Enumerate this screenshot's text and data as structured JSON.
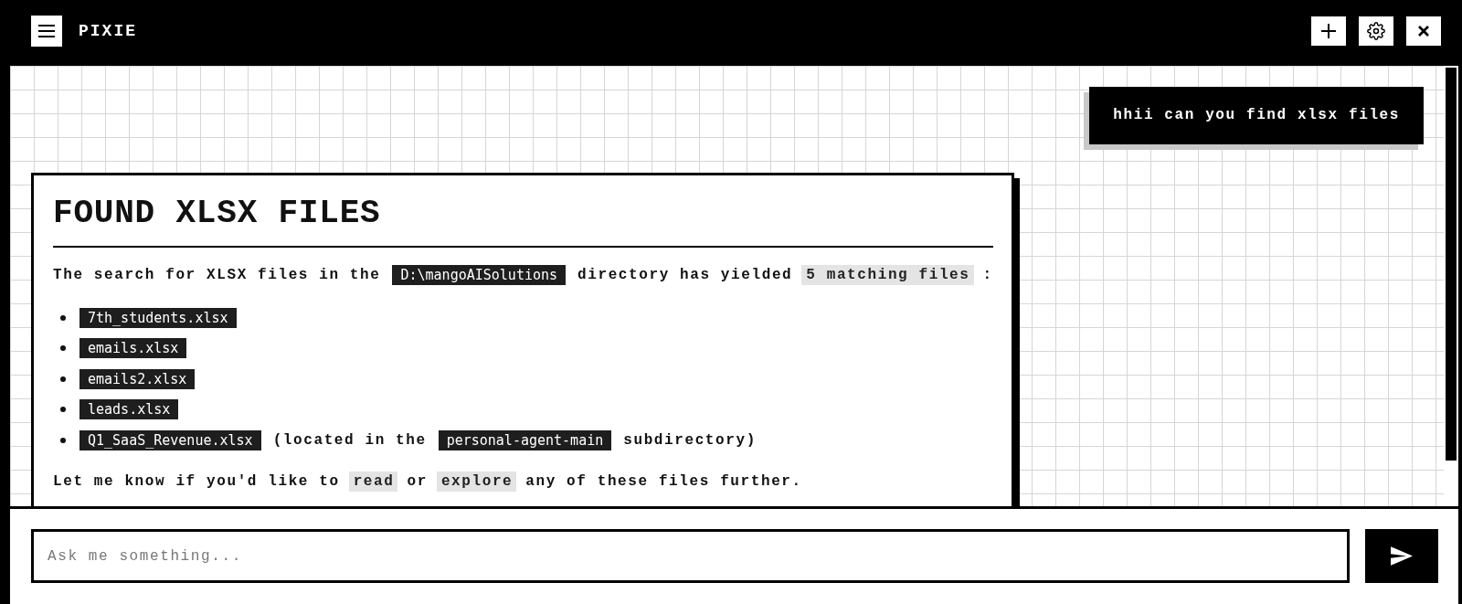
{
  "header": {
    "title": "PIXIE"
  },
  "conversation": [
    {
      "kind": "user",
      "text": "hhii can you find xlsx files"
    },
    {
      "kind": "assistant",
      "heading": "FOUND XLSX FILES",
      "blocks": [
        {
          "kind": "paragraph",
          "parts": [
            {
              "kind": "text",
              "text": "The search for XLSX files in the"
            },
            {
              "kind": "code",
              "text": "D:\\mangoAISolutions"
            },
            {
              "kind": "text",
              "text": "directory has yielded"
            },
            {
              "kind": "highlight",
              "text": "5 matching files"
            },
            {
              "kind": "text",
              "text": ":"
            }
          ]
        },
        {
          "kind": "list",
          "items": [
            {
              "parts": [
                {
                  "kind": "code",
                  "text": "7th_students.xlsx"
                }
              ]
            },
            {
              "parts": [
                {
                  "kind": "code",
                  "text": "emails.xlsx"
                }
              ]
            },
            {
              "parts": [
                {
                  "kind": "code",
                  "text": "emails2.xlsx"
                }
              ]
            },
            {
              "parts": [
                {
                  "kind": "code",
                  "text": "leads.xlsx"
                }
              ]
            },
            {
              "parts": [
                {
                  "kind": "code",
                  "text": "Q1_SaaS_Revenue.xlsx"
                },
                {
                  "kind": "text",
                  "text": "(located in the"
                },
                {
                  "kind": "code",
                  "text": "personal-agent-main"
                },
                {
                  "kind": "text",
                  "text": "subdirectory)"
                }
              ]
            }
          ]
        },
        {
          "kind": "paragraph",
          "parts": [
            {
              "kind": "text",
              "text": "Let me know if you'd like to"
            },
            {
              "kind": "highlight",
              "text": "read"
            },
            {
              "kind": "text",
              "text": "or"
            },
            {
              "kind": "highlight",
              "text": "explore"
            },
            {
              "kind": "text",
              "text": "any of these files further."
            }
          ]
        }
      ]
    }
  ],
  "composer": {
    "placeholder": "Ask me something..."
  }
}
